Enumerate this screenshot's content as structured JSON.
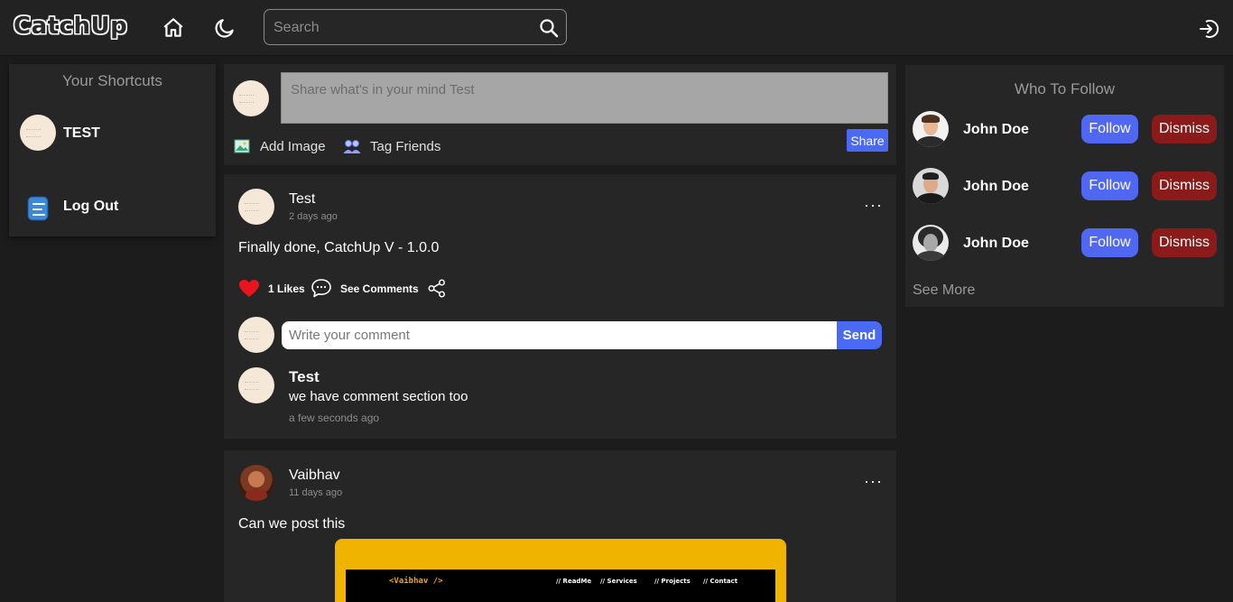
{
  "app": {
    "logo": "CatchUp"
  },
  "nav": {
    "search_placeholder": "Search"
  },
  "shortcuts": {
    "title": "Your Shortcuts",
    "items": [
      {
        "label": "TEST"
      },
      {
        "label": "Log Out"
      }
    ]
  },
  "composer": {
    "placeholder": "Share what's in your mind Test",
    "add_image": "Add Image",
    "tag_friends": "Tag Friends",
    "share": "Share"
  },
  "posts": [
    {
      "author": "Test",
      "time": "2 days ago",
      "text": "Finally done, CatchUp V - 1.0.0",
      "likes": "1 Likes",
      "see_comments": "See Comments",
      "comment_placeholder": "Write your comment",
      "send": "Send",
      "comments": [
        {
          "author": "Test",
          "text": "we have comment section too",
          "time": "a few seconds ago"
        }
      ]
    },
    {
      "author": "Vaibhav",
      "time": "11 days ago",
      "text": "Can we post this",
      "image": {
        "logo": "<Vaibhav />",
        "nav": [
          "// ReadMe",
          "// Services",
          "// Projects",
          "// Contact"
        ]
      }
    }
  ],
  "who_to_follow": {
    "title": "Who To Follow",
    "people": [
      {
        "name": "John Doe",
        "follow": "Follow",
        "dismiss": "Dismiss"
      },
      {
        "name": "John Doe",
        "follow": "Follow",
        "dismiss": "Dismiss"
      },
      {
        "name": "John Doe",
        "follow": "Follow",
        "dismiss": "Dismiss"
      }
    ],
    "see_more": "See More"
  },
  "colors": {
    "accent": "#4a69f5",
    "danger": "#8b1a1a",
    "like": "#e8141e",
    "background": "#1c1c1d",
    "card": "#262627"
  },
  "icons": [
    "home-icon",
    "moon-icon",
    "search-icon",
    "logout-icon",
    "shortcut-logout-icon",
    "image-icon",
    "friends-icon",
    "heart-icon",
    "comment-icon",
    "share-icon",
    "more-icon"
  ]
}
